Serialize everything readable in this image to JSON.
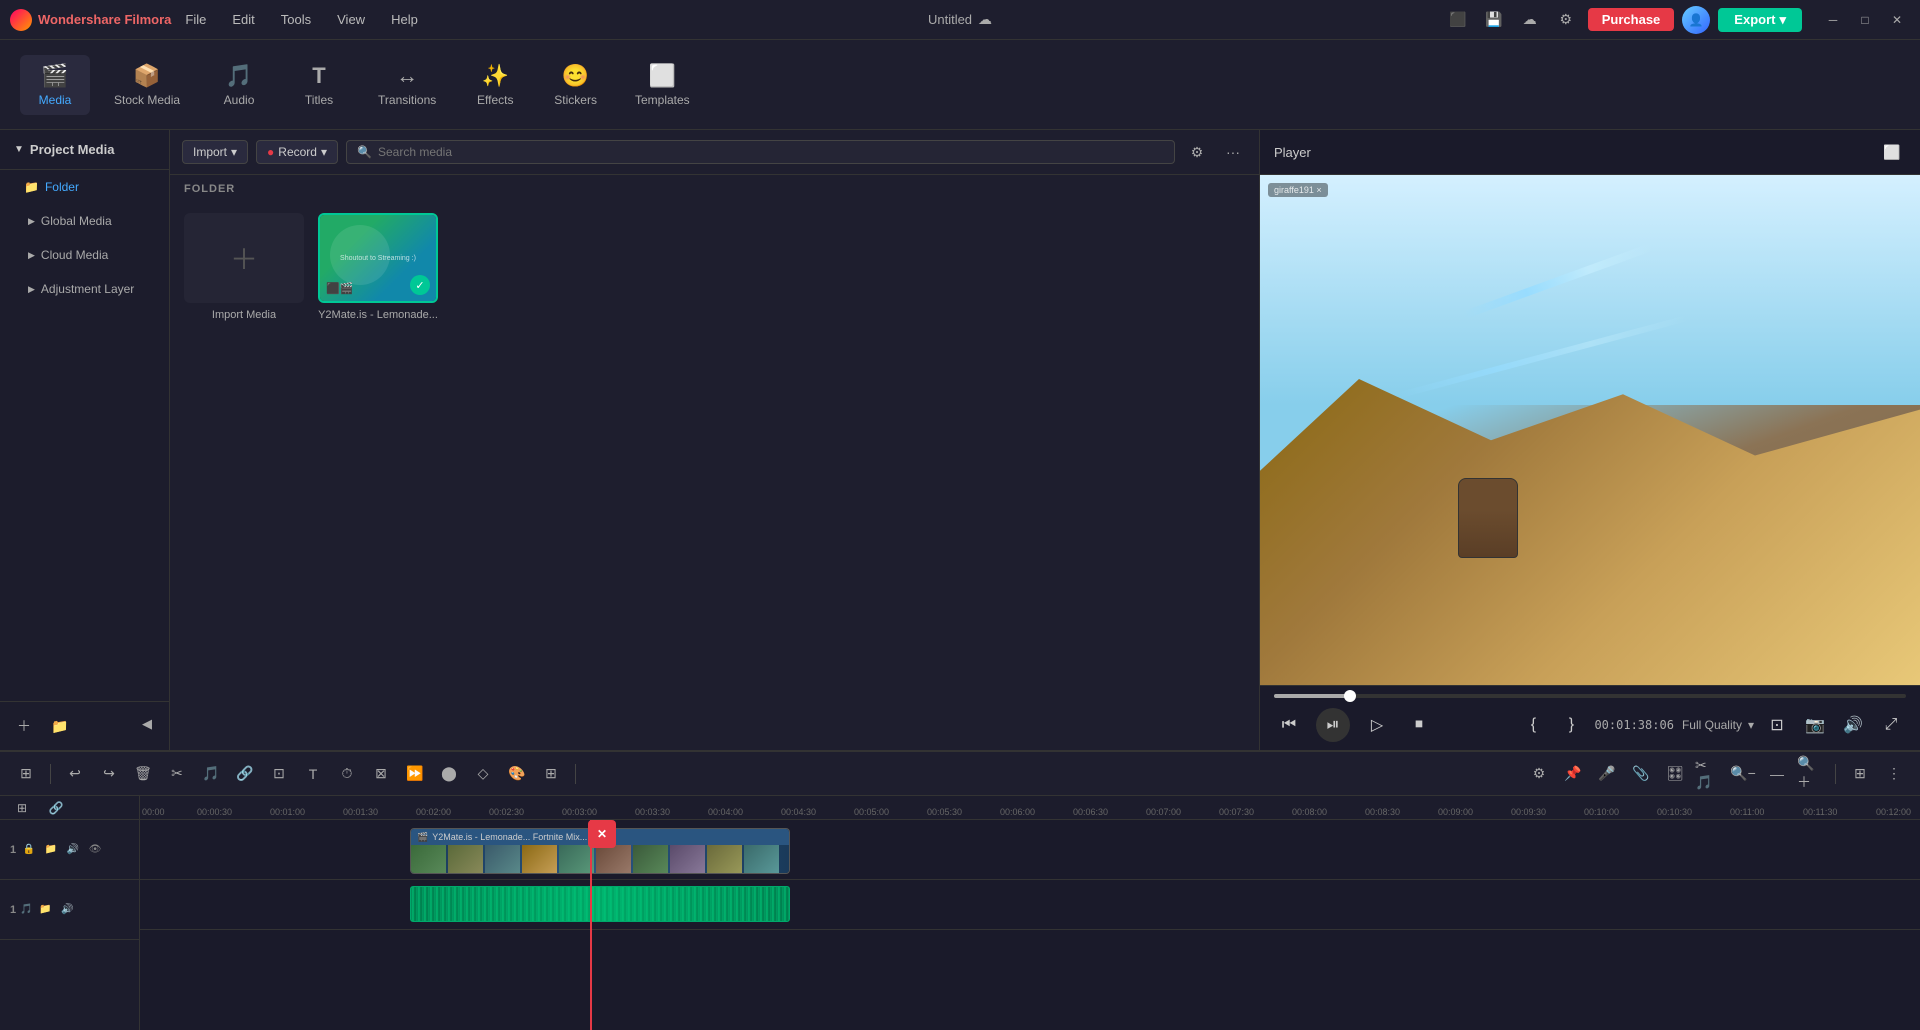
{
  "app": {
    "name": "Wondershare Filmora",
    "title": "Untitled",
    "logo_color": "#e63946"
  },
  "titlebar": {
    "menu_items": [
      "File",
      "Edit",
      "Tools",
      "View",
      "Help"
    ],
    "purchase_label": "Purchase",
    "export_label": "Export",
    "win_minimize": "─",
    "win_maximize": "□",
    "win_close": "✕"
  },
  "toolbar": {
    "items": [
      {
        "id": "media",
        "label": "Media",
        "icon": "🎬",
        "active": true
      },
      {
        "id": "stock-media",
        "label": "Stock Media",
        "icon": "📦"
      },
      {
        "id": "audio",
        "label": "Audio",
        "icon": "🎵"
      },
      {
        "id": "titles",
        "label": "Titles",
        "icon": "T"
      },
      {
        "id": "transitions",
        "label": "Transitions",
        "icon": "↔"
      },
      {
        "id": "effects",
        "label": "Effects",
        "icon": "✨"
      },
      {
        "id": "stickers",
        "label": "Stickers",
        "icon": "😊"
      },
      {
        "id": "templates",
        "label": "Templates",
        "icon": "⬜"
      }
    ]
  },
  "sidebar": {
    "header": "Project Media",
    "items": [
      {
        "label": "Folder",
        "id": "folder",
        "active": false,
        "selected": true
      },
      {
        "label": "Global Media",
        "id": "global-media"
      },
      {
        "label": "Cloud Media",
        "id": "cloud-media"
      },
      {
        "label": "Adjustment Layer",
        "id": "adjustment-layer"
      }
    ]
  },
  "media_panel": {
    "import_label": "Import",
    "record_label": "Record",
    "search_placeholder": "Search media",
    "folder_label": "FOLDER",
    "items": [
      {
        "id": "import",
        "label": "Import Media",
        "type": "add"
      },
      {
        "id": "y2mate",
        "label": "Y2Mate.is - Lemonade...",
        "type": "video",
        "selected": true
      }
    ]
  },
  "player": {
    "header": "Player",
    "quality_label": "Full Quality",
    "time": "00:01:38:06"
  },
  "timeline": {
    "tracks": [
      {
        "num": "1",
        "type": "video",
        "icon": "🎬"
      },
      {
        "num": "1",
        "type": "audio",
        "icon": "🎵"
      }
    ],
    "ruler_marks": [
      "00:00",
      "00:00:30",
      "00:01:00",
      "00:01:30",
      "00:02:00",
      "00:02:30",
      "00:03:00",
      "00:03:30",
      "00:04:00",
      "00:04:30",
      "00:05:00",
      "00:05:30",
      "00:06:00",
      "00:06:30",
      "00:07:00",
      "00:07:30",
      "00:08:00",
      "00:08:30",
      "00:09:00",
      "00:09:30",
      "00:10:00",
      "00:10:30",
      "00:11:00",
      "00:11:30",
      "00:12:00"
    ]
  }
}
